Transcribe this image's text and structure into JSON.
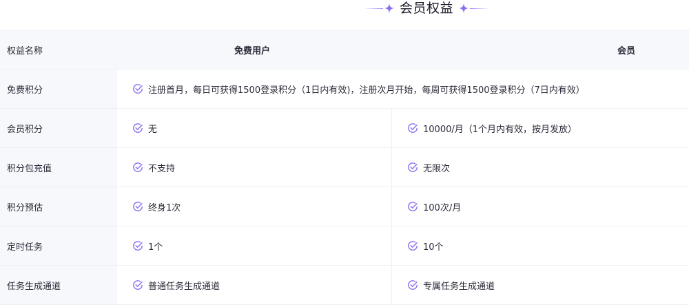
{
  "title": "会员权益",
  "accent_color": "#8b6cf0",
  "header": {
    "name_col": "权益名称",
    "free_col": "免费用户",
    "member_col": "会员"
  },
  "rows": [
    {
      "name": "免费积分",
      "merged": "注册首月，每日可获得1500登录积分（1日内有效)，注册次月开始，每周可获得1500登录积分（7日内有效）"
    },
    {
      "name": "会员积分",
      "free": "无",
      "member": "10000/月（1个月内有效，按月发放）"
    },
    {
      "name": "积分包充值",
      "free": "不支持",
      "member": "无限次"
    },
    {
      "name": "积分预估",
      "free": "终身1次",
      "member": "100次/月"
    },
    {
      "name": "定时任务",
      "free": "1个",
      "member": "10个"
    },
    {
      "name": "任务生成通道",
      "free": "普通任务生成通道",
      "member": "专属任务生成通道"
    }
  ]
}
